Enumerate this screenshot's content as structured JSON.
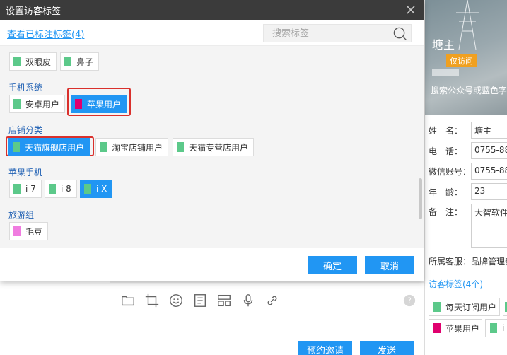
{
  "dialog": {
    "title": "设置访客标签",
    "view_tagged_link": "查看已标注标签(4)",
    "search_placeholder": "搜索标签",
    "confirm": "确定",
    "cancel": "取消",
    "groups": [
      {
        "title": "",
        "tags": [
          {
            "label": "双眼皮",
            "color": "#5cc98a",
            "selected": false
          },
          {
            "label": "鼻子",
            "color": "#5cc98a",
            "selected": false
          }
        ]
      },
      {
        "title": "手机系统",
        "tags": [
          {
            "label": "安卓用户",
            "color": "#5cc98a",
            "selected": false
          },
          {
            "label": "苹果用户",
            "color": "#e0006e",
            "selected": true
          }
        ]
      },
      {
        "title": "店铺分类",
        "tags": [
          {
            "label": "天猫旗舰店用户",
            "color": "#5cc98a",
            "selected": true
          },
          {
            "label": "淘宝店铺用户",
            "color": "#5cc98a",
            "selected": false
          },
          {
            "label": "天猫专营店用户",
            "color": "#5cc98a",
            "selected": false
          }
        ]
      },
      {
        "title": "苹果手机",
        "tags": [
          {
            "label": "i 7",
            "color": "#5cc98a",
            "selected": false
          },
          {
            "label": "i 8",
            "color": "#5cc98a",
            "selected": false
          },
          {
            "label": "i X",
            "color": "#5cc98a",
            "selected": true
          }
        ]
      },
      {
        "title": "旅游组",
        "tags": [
          {
            "label": "毛豆",
            "color": "#f07ce0",
            "selected": false
          }
        ]
      }
    ]
  },
  "chat": {
    "schedule_invite": "预约邀请",
    "send": "发送"
  },
  "profile": {
    "name": "塘主",
    "badge": "仅访问",
    "search_hint": "搜索公众号或蓝色字",
    "fields": [
      {
        "label": "姓　名：",
        "value": "塘主"
      },
      {
        "label": "电　话：",
        "value": "0755-88"
      },
      {
        "label": "微信账号：",
        "value": "0755-88"
      },
      {
        "label": "年　龄：",
        "value": "23"
      }
    ],
    "note_label": "备　注：",
    "note_value": "大智软件",
    "service_label": "所属客服：品牌管理部",
    "tags_title": "访客标签(4个)",
    "tags": [
      {
        "label": "每天订阅用户",
        "color": "#5cc98a"
      },
      {
        "label": "苹果用户",
        "color": "#e0006e"
      },
      {
        "label": "i X",
        "color": "#5cc98a"
      }
    ]
  },
  "colors": {
    "accent": "#2196f3",
    "titlebar": "#3b3b3b",
    "highlight_outline": "#d9302c"
  }
}
